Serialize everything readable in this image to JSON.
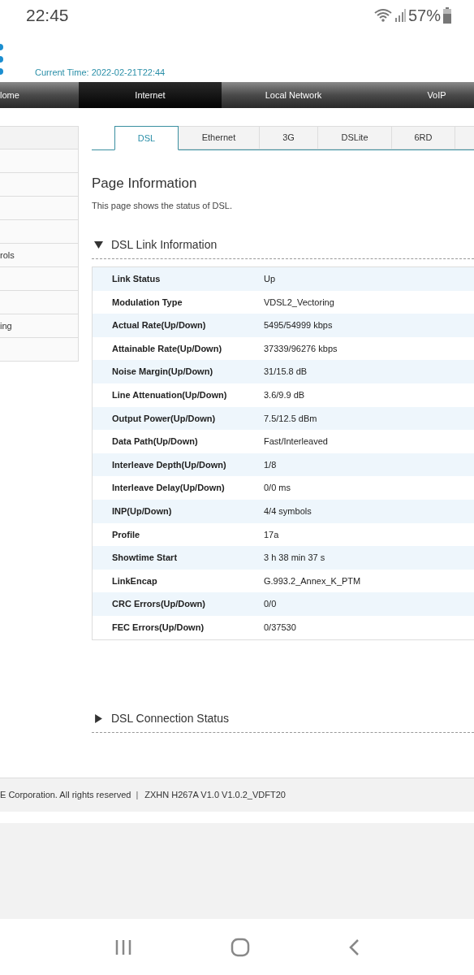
{
  "status_bar": {
    "time": "22:45",
    "battery": "57%"
  },
  "header": {
    "current_time": "Current Time: 2022-02-21T22:44"
  },
  "nav": [
    {
      "label": "lome",
      "selected": false
    },
    {
      "label": "Internet",
      "selected": true
    },
    {
      "label": "Local Network",
      "selected": false
    },
    {
      "label": "VoIP",
      "selected": false
    }
  ],
  "sidebar": {
    "items": [
      {
        "kind": "blank"
      },
      {
        "kind": "blank"
      },
      {
        "kind": "blank"
      },
      {
        "kind": "blank"
      },
      {
        "kind": "text",
        "label": "rols"
      },
      {
        "kind": "blank"
      },
      {
        "kind": "blank"
      },
      {
        "kind": "text",
        "label": "ing"
      },
      {
        "kind": "blank"
      }
    ]
  },
  "tabs": [
    {
      "label": "DSL",
      "selected": true
    },
    {
      "label": "Ethernet",
      "selected": false
    },
    {
      "label": "3G",
      "selected": false
    },
    {
      "label": "DSLite",
      "selected": false
    },
    {
      "label": "6RD",
      "selected": false
    },
    {
      "selected": false
    }
  ],
  "page_info": {
    "title": "Page Information",
    "description": "This page shows the status of DSL."
  },
  "sections": [
    {
      "title": "DSL Link Information",
      "expanded": true,
      "rows": [
        {
          "label": "Link Status",
          "value": "Up"
        },
        {
          "label": "Modulation Type",
          "value": "VDSL2_Vectoring"
        },
        {
          "label": "Actual Rate(Up/Down)",
          "value": "5495/54999 kbps"
        },
        {
          "label": "Attainable Rate(Up/Down)",
          "value": "37339/96276 kbps"
        },
        {
          "label": "Noise Margin(Up/Down)",
          "value": "31/15.8 dB"
        },
        {
          "label": "Line Attenuation(Up/Down)",
          "value": "3.6/9.9 dB"
        },
        {
          "label": "Output Power(Up/Down)",
          "value": "7.5/12.5 dBm"
        },
        {
          "label": "Data Path(Up/Down)",
          "value": "Fast/Interleaved"
        },
        {
          "label": "Interleave Depth(Up/Down)",
          "value": "1/8"
        },
        {
          "label": "Interleave Delay(Up/Down)",
          "value": "0/0 ms"
        },
        {
          "label": "INP(Up/Down)",
          "value": "4/4 symbols"
        },
        {
          "label": "Profile",
          "value": "17a"
        },
        {
          "label": "Showtime Start",
          "value": "3 h 38 min 37 s"
        },
        {
          "label": "LinkEncap",
          "value": "G.993.2_Annex_K_PTM"
        },
        {
          "label": "CRC Errors(Up/Down)",
          "value": "0/0"
        },
        {
          "label": "FEC Errors(Up/Down)",
          "value": "0/37530"
        }
      ]
    },
    {
      "title": "DSL Connection Status",
      "expanded": false
    }
  ],
  "footer": {
    "copyright": "E Corporation. All rights reserved",
    "separator": "|",
    "version": "ZXHN H267A V1.0 V1.0.2_VDFT20"
  }
}
